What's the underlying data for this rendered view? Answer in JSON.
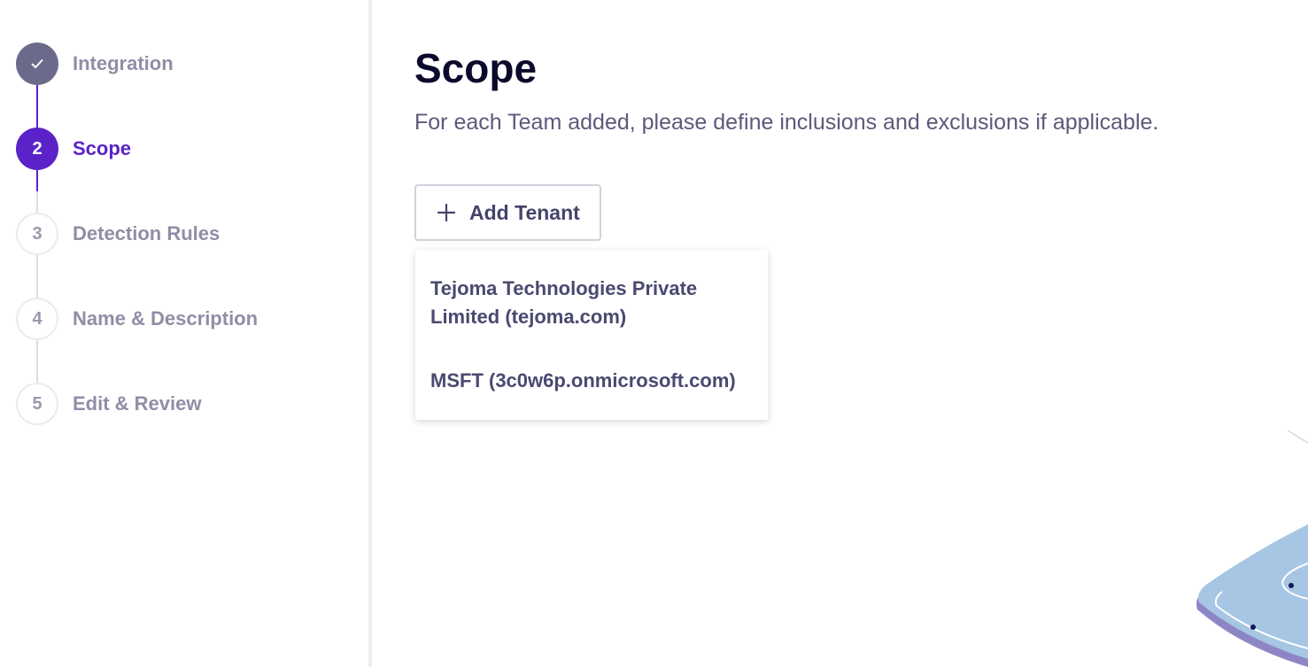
{
  "stepper": {
    "steps": [
      {
        "number": "",
        "label": "Integration",
        "status": "completed"
      },
      {
        "number": "2",
        "label": "Scope",
        "status": "active"
      },
      {
        "number": "3",
        "label": "Detection Rules",
        "status": "pending"
      },
      {
        "number": "4",
        "label": "Name & Description",
        "status": "pending"
      },
      {
        "number": "5",
        "label": "Edit & Review",
        "status": "pending"
      }
    ]
  },
  "main": {
    "title": "Scope",
    "subtitle": "For each Team added, please define inclusions and exclusions if applicable.",
    "add_button_label": "Add Tenant",
    "tenant_options": [
      "Tejoma Technologies Private Limited (tejoma.com)",
      "MSFT (3c0w6p.onmicrosoft.com)"
    ]
  },
  "icons": {
    "completed_step": "check-icon",
    "add_button": "plus-icon"
  },
  "colors": {
    "accent": "#5a22c8",
    "completed": "#6c6a8a",
    "pending_text": "#8f8ea6",
    "title": "#0b0a2a",
    "body_text": "#5b5a7c"
  }
}
